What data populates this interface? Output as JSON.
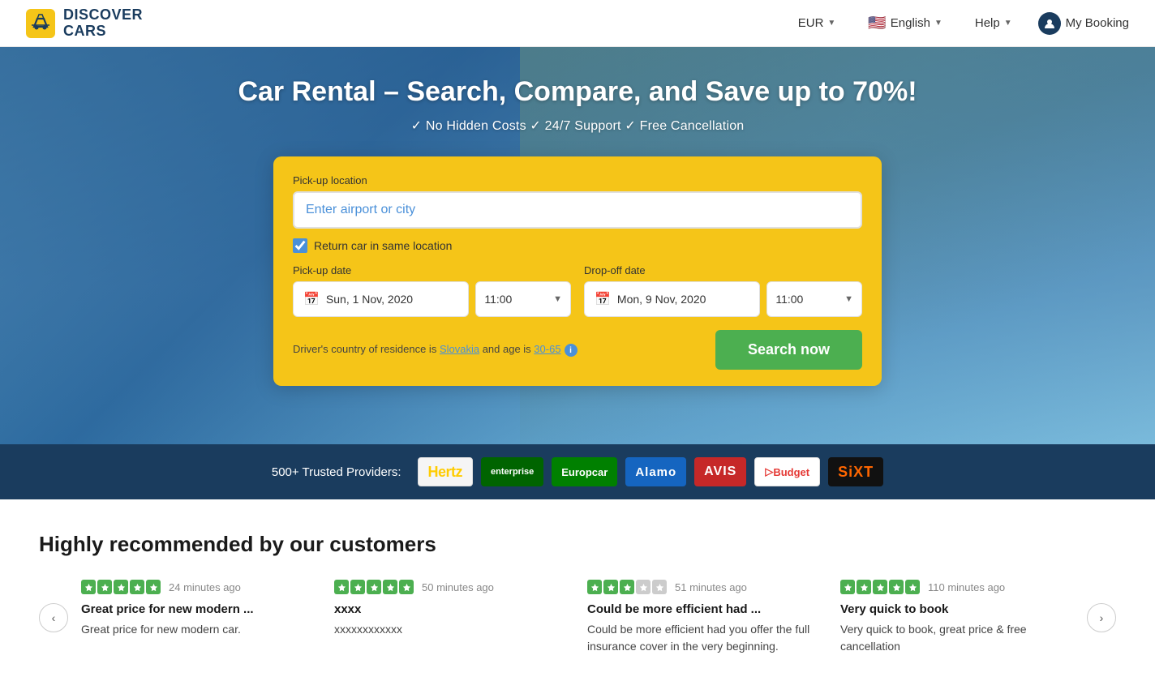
{
  "header": {
    "logo_line1": "DISCOVER",
    "logo_line2": "CARS",
    "nav": {
      "currency": "EUR",
      "language": "English",
      "help": "Help",
      "my_booking": "My Booking"
    }
  },
  "hero": {
    "title": "Car Rental – Search, Compare, and Save up to 70%!",
    "subtitle": "✓ No Hidden Costs ✓ 24/7 Support ✓ Free Cancellation",
    "search": {
      "pickup_label": "Pick-up location",
      "pickup_placeholder": "Enter airport or city",
      "return_label": "Return car in same location",
      "return_checked": true,
      "pickup_date_label": "Pick-up date",
      "pickup_date": "Sun, 1 Nov, 2020",
      "pickup_time": "11:00",
      "dropoff_date_label": "Drop-off date",
      "dropoff_date": "Mon, 9 Nov, 2020",
      "dropoff_time": "11:00",
      "driver_text_prefix": "Driver's country of residence is ",
      "driver_country": "Slovakia",
      "driver_text_mid": " and age is ",
      "driver_age": "30-65",
      "search_btn": "Search now"
    }
  },
  "providers": {
    "label": "500+ Trusted Providers:",
    "logos": [
      {
        "name": "Hertz",
        "class": "logo-hertz"
      },
      {
        "name": "enterprise",
        "class": "logo-enterprise"
      },
      {
        "name": "Europcar",
        "class": "logo-europcar"
      },
      {
        "name": "Alamo",
        "class": "logo-alamo"
      },
      {
        "name": "AVIS",
        "class": "logo-avis"
      },
      {
        "name": "Budget",
        "class": "logo-budget"
      },
      {
        "name": "SiXT",
        "class": "logo-sixt"
      }
    ]
  },
  "reviews": {
    "section_title": "Highly recommended by our customers",
    "items": [
      {
        "stars": 5,
        "time_ago": "24 minutes ago",
        "title": "Great price for new modern ...",
        "text": "Great price for new modern car."
      },
      {
        "stars": 5,
        "time_ago": "50 minutes ago",
        "title": "xxxx",
        "text": "xxxxxxxxxxxx"
      },
      {
        "stars": 3,
        "time_ago": "51 minutes ago",
        "title": "Could be more efficient had ...",
        "text": "Could be more efficient had you offer the full insurance cover in the very beginning."
      },
      {
        "stars": 5,
        "time_ago": "110 minutes ago",
        "title": "Very quick to book",
        "text": "Very quick to book, great price & free cancellation"
      }
    ]
  }
}
